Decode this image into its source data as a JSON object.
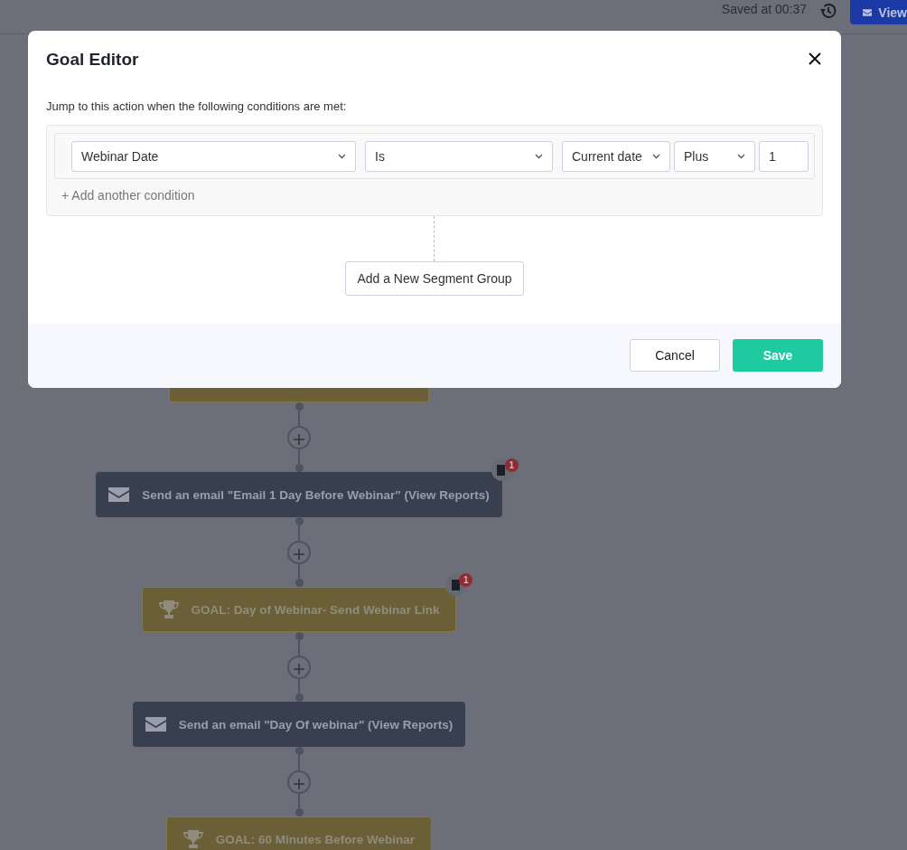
{
  "header": {
    "saved_text": "Saved at 00:37",
    "view_button": "View"
  },
  "flow": {
    "nodes": [
      {
        "kind": "goal"
      },
      {
        "kind": "email",
        "label": "Send an email \"Email 1 Day Before Webinar\" (View Reports)",
        "badge": "1"
      },
      {
        "kind": "goal",
        "label": "GOAL: Day of Webinar- Send Webinar Link",
        "badge": "1"
      },
      {
        "kind": "email",
        "label": "Send an email \"Day Of webinar\" (View Reports)"
      },
      {
        "kind": "goal",
        "label": "GOAL: 60 Minutes Before Webinar"
      }
    ]
  },
  "modal": {
    "title": "Goal Editor",
    "instruction": "Jump to this action when the following conditions are met:",
    "conditions": [
      {
        "field": "Webinar Date",
        "operator": "Is",
        "value": "Current date",
        "modifier": "Plus",
        "amount": "1"
      }
    ],
    "add_condition": "+ Add another condition",
    "add_group": "Add a New Segment Group",
    "cancel": "Cancel",
    "save": "Save"
  }
}
